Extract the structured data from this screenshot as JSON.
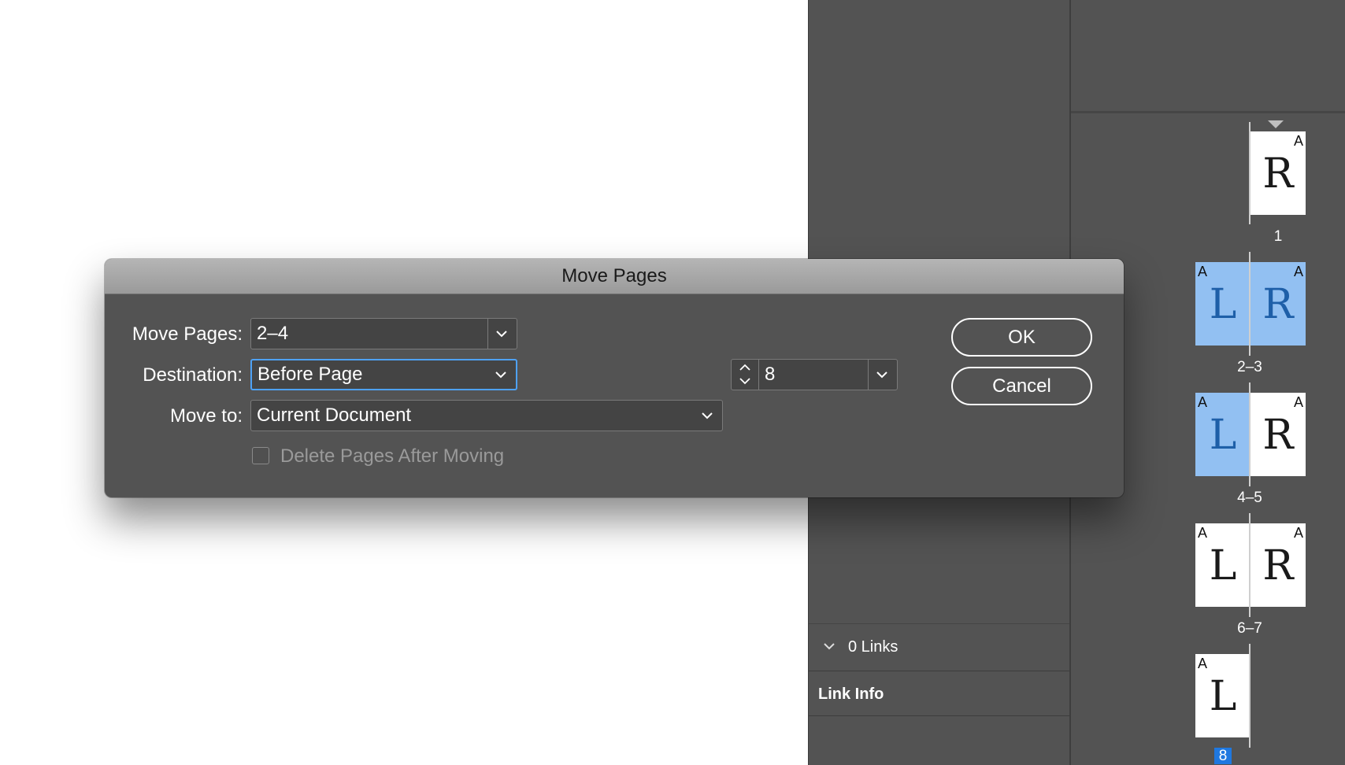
{
  "dialog": {
    "title": "Move Pages",
    "move_pages_label": "Move Pages:",
    "move_pages_value": "2–4",
    "destination_label": "Destination:",
    "destination_value": "Before Page",
    "destination_page_value": "8",
    "move_to_label": "Move to:",
    "move_to_value": "Current Document",
    "delete_after_label": "Delete Pages After Moving",
    "delete_after_checked": false,
    "ok_label": "OK",
    "cancel_label": "Cancel"
  },
  "links_panel": {
    "links_count": "0 Links",
    "link_info_label": "Link Info"
  },
  "pages_panel": {
    "spreads": [
      {
        "label": "1",
        "pages": [
          {
            "letter": "R",
            "master": "A",
            "selected": false
          }
        ]
      },
      {
        "label": "2–3",
        "pages": [
          {
            "letter": "L",
            "master": "A",
            "selected": true
          },
          {
            "letter": "R",
            "master": "A",
            "selected": true
          }
        ]
      },
      {
        "label": "4–5",
        "pages": [
          {
            "letter": "L",
            "master": "A",
            "selected": true
          },
          {
            "letter": "R",
            "master": "A",
            "selected": false
          }
        ]
      },
      {
        "label": "6–7",
        "pages": [
          {
            "letter": "L",
            "master": "A",
            "selected": false
          },
          {
            "letter": "R",
            "master": "A",
            "selected": false
          }
        ]
      },
      {
        "label": "8",
        "current": true,
        "pages": [
          {
            "letter": "L",
            "master": "A",
            "selected": false
          }
        ]
      }
    ]
  },
  "colors": {
    "selection": "#92c0f2",
    "focus_ring": "#4ea1f5",
    "current_page_badge": "#1f78e0",
    "panel_bg": "#535353"
  }
}
